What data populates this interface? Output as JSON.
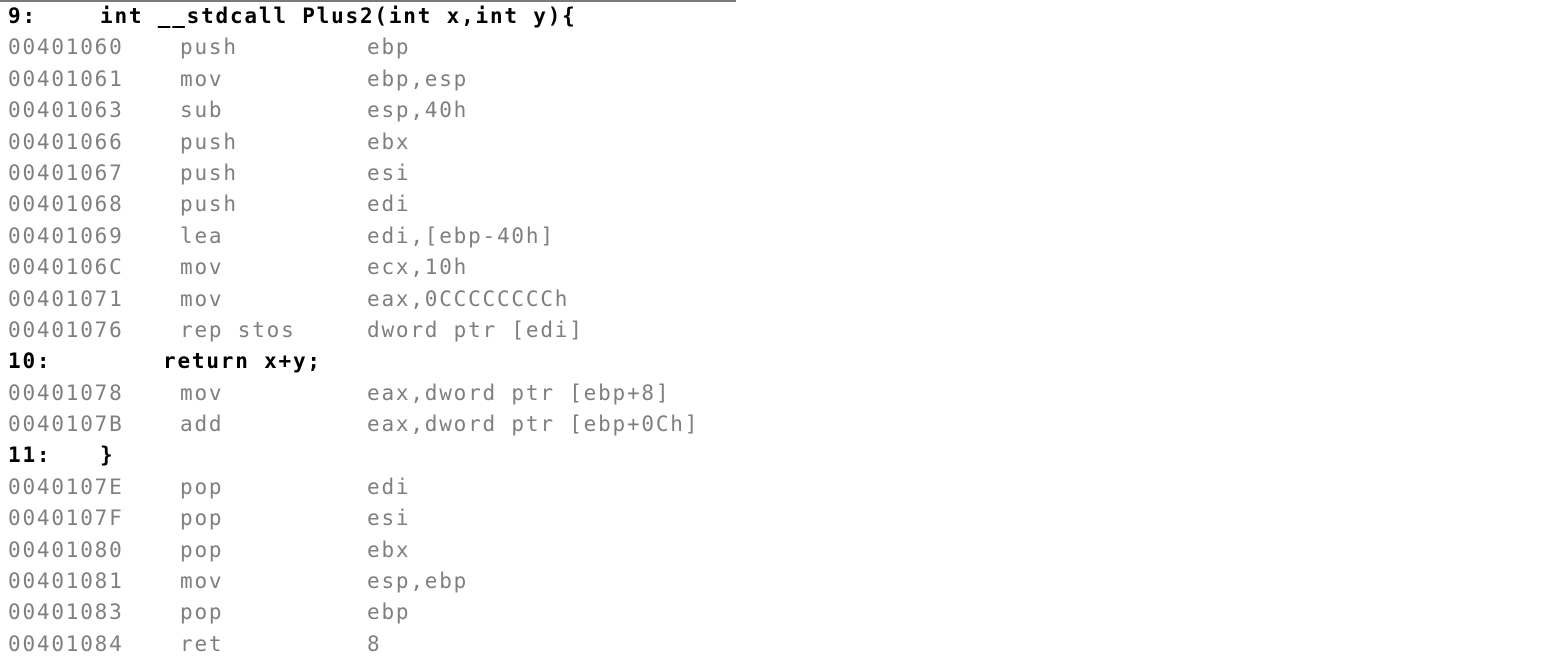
{
  "lines": [
    {
      "type": "src",
      "num": "9:",
      "code": "int __stdcall Plus2(int x,int y){",
      "indent": "100"
    },
    {
      "type": "asm",
      "addr": "00401060",
      "mnemonic": "push",
      "operands": "ebp"
    },
    {
      "type": "asm",
      "addr": "00401061",
      "mnemonic": "mov",
      "operands": "ebp,esp"
    },
    {
      "type": "asm",
      "addr": "00401063",
      "mnemonic": "sub",
      "operands": "esp,40h"
    },
    {
      "type": "asm",
      "addr": "00401066",
      "mnemonic": "push",
      "operands": "ebx"
    },
    {
      "type": "asm",
      "addr": "00401067",
      "mnemonic": "push",
      "operands": "esi"
    },
    {
      "type": "asm",
      "addr": "00401068",
      "mnemonic": "push",
      "operands": "edi"
    },
    {
      "type": "asm",
      "addr": "00401069",
      "mnemonic": "lea",
      "operands": "edi,[ebp-40h]"
    },
    {
      "type": "asm",
      "addr": "0040106C",
      "mnemonic": "mov",
      "operands": "ecx,10h"
    },
    {
      "type": "asm",
      "addr": "00401071",
      "mnemonic": "mov",
      "operands": "eax,0CCCCCCCCh"
    },
    {
      "type": "asm",
      "addr": "00401076",
      "mnemonic": "rep stos",
      "operands": "dword ptr [edi]"
    },
    {
      "type": "src",
      "num": "10:",
      "code": "return x+y;",
      "indent": "163"
    },
    {
      "type": "asm",
      "addr": "00401078",
      "mnemonic": "mov",
      "operands": "eax,dword ptr [ebp+8]"
    },
    {
      "type": "asm",
      "addr": "0040107B",
      "mnemonic": "add",
      "operands": "eax,dword ptr [ebp+0Ch]"
    },
    {
      "type": "src",
      "num": "11:",
      "code": "}",
      "indent": "100"
    },
    {
      "type": "asm",
      "addr": "0040107E",
      "mnemonic": "pop",
      "operands": "edi"
    },
    {
      "type": "asm",
      "addr": "0040107F",
      "mnemonic": "pop",
      "operands": "esi"
    },
    {
      "type": "asm",
      "addr": "00401080",
      "mnemonic": "pop",
      "operands": "ebx"
    },
    {
      "type": "asm",
      "addr": "00401081",
      "mnemonic": "mov",
      "operands": "esp,ebp"
    },
    {
      "type": "asm",
      "addr": "00401083",
      "mnemonic": "pop",
      "operands": "ebp"
    },
    {
      "type": "asm",
      "addr": "00401084",
      "mnemonic": "ret",
      "operands": "8"
    }
  ],
  "colors": {
    "source": "#000000",
    "asm": "#7f7f7f"
  }
}
